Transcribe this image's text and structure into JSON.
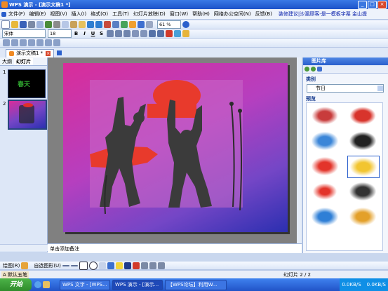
{
  "window": {
    "title": "WPS 演示 - [演示文稿1 *]",
    "min": "_",
    "max": "□",
    "close": "×"
  },
  "menu": {
    "items": [
      "文件(F)",
      "编辑(E)",
      "视图(V)",
      "插入(I)",
      "格式(O)",
      "工具(T)",
      "幻灯片放映(D)",
      "窗口(W)",
      "帮助(H)",
      "网络办公空间(N)"
    ],
    "feedback": "反馈(B)",
    "ad_text": "装修建议|沙漏顾客-是一模板字幕 金山提"
  },
  "formatting": {
    "font": "宋体",
    "size": "18",
    "bold": "B",
    "italic": "I",
    "underline": "U",
    "shadow": "S"
  },
  "toolbar": {
    "zoom": "61 %"
  },
  "tabs": {
    "document": "演示文稿1 *"
  },
  "left_panel": {
    "tab_outline": "大纲",
    "tab_slides": "幻灯片",
    "slide_numbers": [
      "1",
      "2"
    ],
    "thumb1_text": "春天"
  },
  "notes": {
    "placeholder": "单击添加备注"
  },
  "task_pane": {
    "title": "图片库",
    "category_label": "类别",
    "category_value": "节日",
    "preview_label": "预览"
  },
  "drawing": {
    "draw_menu": "绘图(R)",
    "autoshape_menu": "自选图形(U)"
  },
  "status": {
    "slide_counter": "幻灯片 2 / 2",
    "left_indicator": "A 默认五笔"
  },
  "taskbar": {
    "start": "开始",
    "tasks": [
      "WPS 文字 - [WPS...",
      "WPS 演示 - [演示...",
      "【WPS论坛】利用W..."
    ],
    "tray": [
      "0.0KB/S",
      "0.0KB/S"
    ]
  },
  "colors": {
    "accent": "#2a5fcc",
    "slide_magenta": "#d92d9a",
    "slide_blue": "#2b2fb0"
  }
}
